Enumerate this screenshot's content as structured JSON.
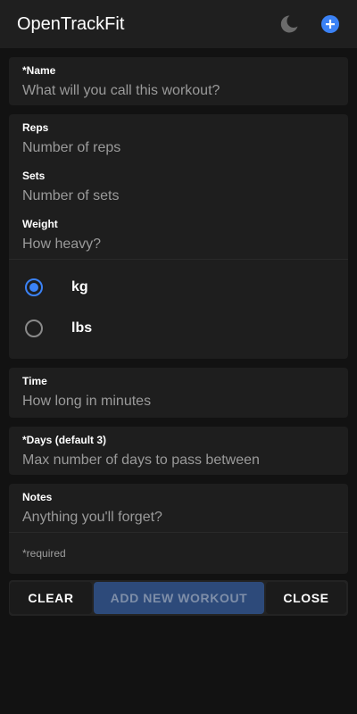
{
  "app": {
    "title": "OpenTrackFit"
  },
  "header": {
    "theme_icon": "moon-icon",
    "add_icon": "plus-circle-icon",
    "accent_color": "#3b82f6"
  },
  "form": {
    "name": {
      "label": "*Name",
      "placeholder": "What will you call this workout?",
      "value": ""
    },
    "reps": {
      "label": "Reps",
      "placeholder": "Number of reps",
      "value": ""
    },
    "sets": {
      "label": "Sets",
      "placeholder": "Number of sets",
      "value": ""
    },
    "weight": {
      "label": "Weight",
      "placeholder": "How heavy?",
      "value": ""
    },
    "unit": {
      "options": [
        {
          "label": "kg",
          "checked": true
        },
        {
          "label": "lbs",
          "checked": false
        }
      ]
    },
    "time": {
      "label": "Time",
      "placeholder": "How long in minutes",
      "value": ""
    },
    "days": {
      "label": "*Days (default 3)",
      "placeholder": "Max number of days to pass between",
      "value": ""
    },
    "notes": {
      "label": "Notes",
      "placeholder": "Anything you'll forget?",
      "value": ""
    },
    "required_note": "*required"
  },
  "actions": {
    "clear": "CLEAR",
    "add": "ADD NEW WORKOUT",
    "close": "CLOSE"
  }
}
